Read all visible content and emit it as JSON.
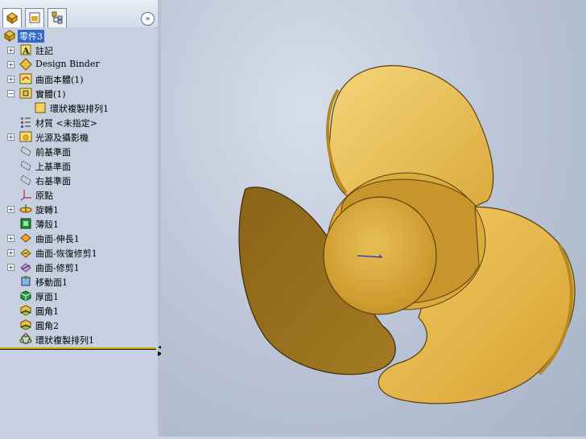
{
  "feature_tree": {
    "tabs": [
      "featuremanager-icon",
      "propertymanager-icon",
      "configurationmanager-icon"
    ],
    "expand_label": "»",
    "root_label": "零件3",
    "items": [
      {
        "label": "註記",
        "icon": "annotations-icon",
        "expandable": true
      },
      {
        "label": "Design Binder",
        "icon": "design-binder-icon",
        "expandable": true
      },
      {
        "label": "曲面本體(1)",
        "icon": "surface-bodies-icon",
        "expandable": true
      },
      {
        "label": "實體(1)",
        "icon": "solid-bodies-icon",
        "expandable": true,
        "expanded": true
      },
      {
        "label": "環狀複製排列1",
        "icon": "circular-pattern-body-icon",
        "expandable": false,
        "child": true
      },
      {
        "label": "材質 <未指定>",
        "icon": "material-icon",
        "expandable": false
      },
      {
        "label": "光源及攝影機",
        "icon": "lights-cameras-icon",
        "expandable": true
      },
      {
        "label": "前基準面",
        "icon": "plane-icon",
        "expandable": false
      },
      {
        "label": "上基準面",
        "icon": "plane-icon",
        "expandable": false
      },
      {
        "label": "右基準面",
        "icon": "plane-icon",
        "expandable": false
      },
      {
        "label": "原點",
        "icon": "origin-icon",
        "expandable": false
      },
      {
        "label": "旋轉1",
        "icon": "revolve-icon",
        "expandable": true
      },
      {
        "label": "薄殼1",
        "icon": "shell-icon",
        "expandable": false
      },
      {
        "label": "曲面-伸長1",
        "icon": "surface-extrude-icon",
        "expandable": true
      },
      {
        "label": "曲面-恢復修剪1",
        "icon": "surface-untrim-icon",
        "expandable": true
      },
      {
        "label": "曲面-修剪1",
        "icon": "surface-trim-icon",
        "expandable": true
      },
      {
        "label": "移動面1",
        "icon": "move-face-icon",
        "expandable": false
      },
      {
        "label": "厚面1",
        "icon": "thicken-icon",
        "expandable": false
      },
      {
        "label": "圓角1",
        "icon": "fillet-icon",
        "expandable": false
      },
      {
        "label": "圓角2",
        "icon": "fillet-icon",
        "expandable": false
      },
      {
        "label": "環狀複製排列1",
        "icon": "circular-pattern-icon",
        "expandable": false
      }
    ]
  },
  "colors": {
    "selection": "#3268c8",
    "rollback_bar": "#d4b000",
    "part": "#d9a93a"
  }
}
